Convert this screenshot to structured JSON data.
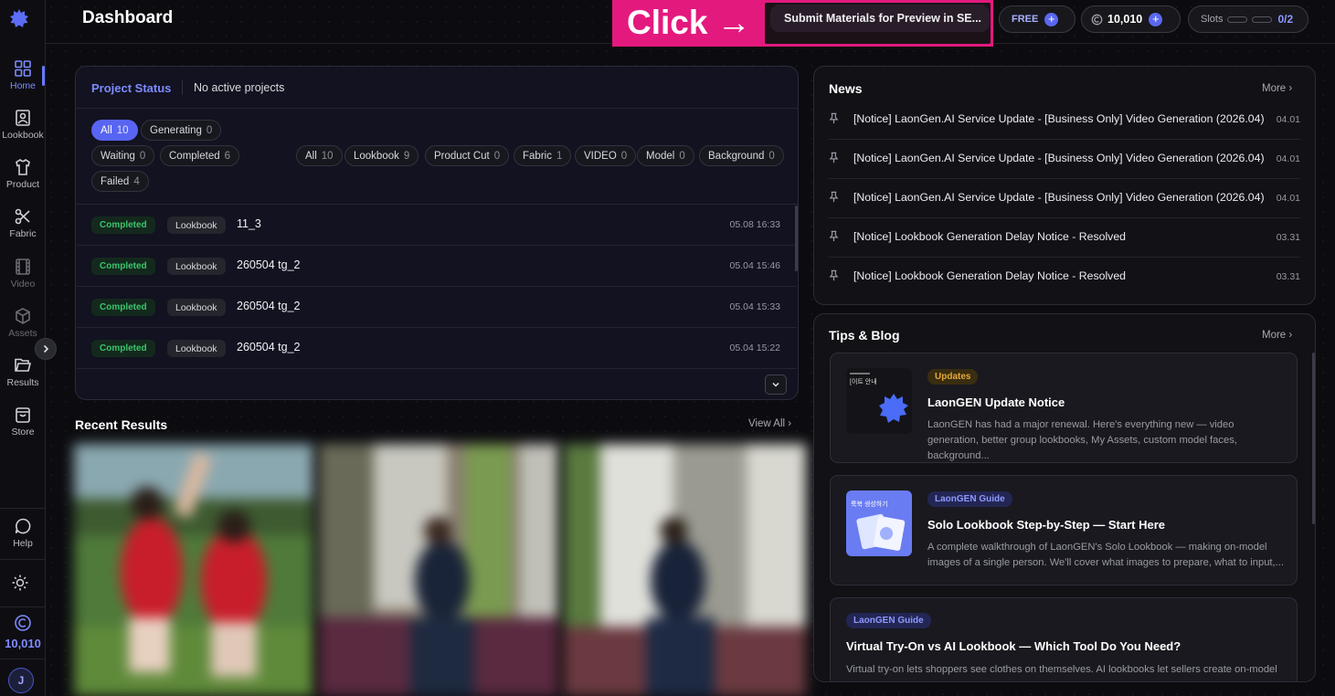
{
  "sidebar": {
    "items": [
      {
        "label": "Home",
        "icon": "home-grid-icon"
      },
      {
        "label": "Lookbook",
        "icon": "image-icon"
      },
      {
        "label": "Product",
        "icon": "shirt-icon"
      },
      {
        "label": "Fabric",
        "icon": "scissors-icon"
      },
      {
        "label": "Video",
        "icon": "film-icon"
      },
      {
        "label": "Assets",
        "icon": "box-icon"
      },
      {
        "label": "Results",
        "icon": "folder-icon"
      },
      {
        "label": "Store",
        "icon": "bag-icon"
      },
      {
        "label": "Help",
        "icon": "chat-icon"
      }
    ],
    "credits": "10,010",
    "avatar_initial": "J"
  },
  "header": {
    "title": "Dashboard",
    "click_overlay": "Click →",
    "submit_button": "Submit Materials for Preview in SE...",
    "plan": "FREE",
    "credits": "10,010",
    "slots_label": "Slots",
    "slots_value": "0/2"
  },
  "project_status": {
    "title": "Project Status",
    "summary": "No active projects",
    "status_filters": [
      {
        "label": "All",
        "count": "10"
      },
      {
        "label": "Generating",
        "count": "0"
      },
      {
        "label": "Waiting",
        "count": "0"
      },
      {
        "label": "Completed",
        "count": "6"
      },
      {
        "label": "Failed",
        "count": "4"
      }
    ],
    "type_filters": [
      {
        "label": "All",
        "count": "10"
      },
      {
        "label": "Lookbook",
        "count": "9"
      },
      {
        "label": "Product Cut",
        "count": "0"
      },
      {
        "label": "Fabric",
        "count": "1"
      },
      {
        "label": "VIDEO",
        "count": "0"
      },
      {
        "label": "Model",
        "count": "0"
      },
      {
        "label": "Background",
        "count": "0"
      }
    ],
    "rows": [
      {
        "status": "Completed",
        "type": "Lookbook",
        "name": "11_3",
        "time": "05.08 16:33"
      },
      {
        "status": "Completed",
        "type": "Lookbook",
        "name": "260504 tg_2",
        "time": "05.04 15:46"
      },
      {
        "status": "Completed",
        "type": "Lookbook",
        "name": "260504 tg_2",
        "time": "05.04 15:33"
      },
      {
        "status": "Completed",
        "type": "Lookbook",
        "name": "260504 tg_2",
        "time": "05.04 15:22"
      }
    ]
  },
  "recent": {
    "title": "Recent Results",
    "view_all": "View All"
  },
  "news": {
    "title": "News",
    "more": "More",
    "items": [
      {
        "text": "[Notice] LaonGen.AI Service Update - [Business Only] Video Generation (2026.04)",
        "date": "04.01"
      },
      {
        "text": "[Notice] LaonGen.AI Service Update - [Business Only] Video Generation (2026.04)",
        "date": "04.01"
      },
      {
        "text": "[Notice] LaonGen.AI Service Update - [Business Only] Video Generation (2026.04)",
        "date": "04.01"
      },
      {
        "text": "[Notice] Lookbook Generation Delay Notice - Resolved",
        "date": "03.31"
      },
      {
        "text": "[Notice] Lookbook Generation Delay Notice - Resolved",
        "date": "03.31"
      }
    ]
  },
  "tips": {
    "title": "Tips & Blog",
    "more": "More",
    "items": [
      {
        "tag": "Updates",
        "title": "LaonGEN Update Notice",
        "desc": "LaonGEN has had a major renewal. Here's everything new — video generation, better group lookbooks, My Assets, custom model faces, background...",
        "thumb_caption": "[이트 안내"
      },
      {
        "tag": "LaonGEN Guide",
        "title": "Solo Lookbook Step-by-Step — Start Here",
        "desc": "A complete walkthrough of LaonGEN's Solo Lookbook — making on-model images of a single person. We'll cover what images to prepare, what to input,...",
        "thumb_caption": "룩북 생성하기"
      },
      {
        "tag": "LaonGEN Guide",
        "title": "Virtual Try-On vs AI Lookbook — Which Tool Do You Need?",
        "desc": "Virtual try-on lets shoppers see clothes on themselves. AI lookbooks let sellers create on-model"
      }
    ]
  },
  "colors": {
    "accent": "#5865f2",
    "highlight": "#e4197e",
    "success": "#3cc46d",
    "update_tag": "#e4a93a"
  }
}
